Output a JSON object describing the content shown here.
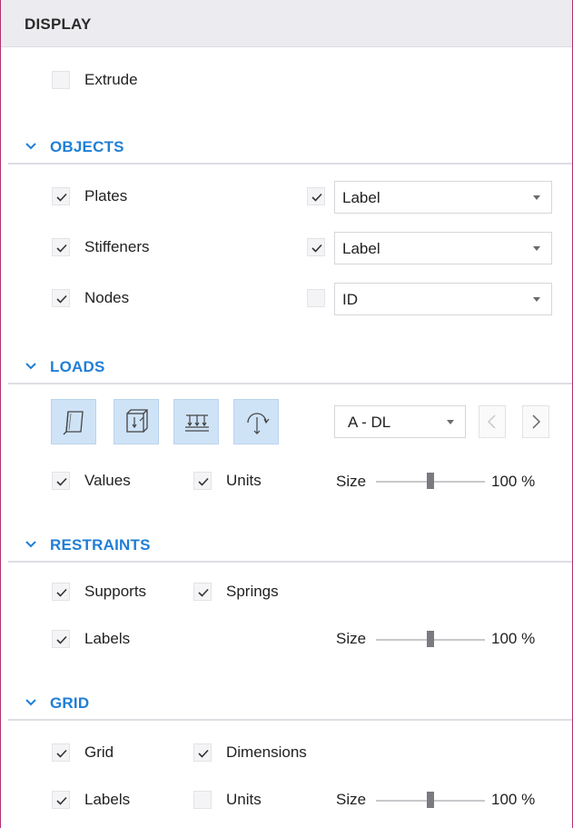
{
  "header": {
    "title": "DISPLAY"
  },
  "display": {
    "extrude_label": "Extrude",
    "extrude_checked": false
  },
  "objects": {
    "title": "OBJECTS",
    "rows": [
      {
        "label": "Plates",
        "checked": true,
        "show": true,
        "option": "Label"
      },
      {
        "label": "Stiffeners",
        "checked": true,
        "show": true,
        "option": "Label"
      },
      {
        "label": "Nodes",
        "checked": true,
        "show": false,
        "option": "ID"
      }
    ]
  },
  "loads": {
    "title": "LOADS",
    "icons": [
      "plate-load-icon",
      "edge-load-icon",
      "distributed-load-icon",
      "moment-load-icon"
    ],
    "case_select": "A - DL",
    "values_label": "Values",
    "units_label": "Units",
    "size_label": "Size",
    "size_value": "100 %",
    "size_level": 0.5
  },
  "restraints": {
    "title": "RESTRAINTS",
    "supports_label": "Supports",
    "springs_label": "Springs",
    "labels_label": "Labels",
    "size_label": "Size",
    "size_value": "100 %",
    "size_level": 0.5
  },
  "grid": {
    "title": "GRID",
    "grid_label": "Grid",
    "dimensions_label": "Dimensions",
    "labels_label": "Labels",
    "units_label": "Units",
    "units_checked": false,
    "size_label": "Size",
    "size_value": "100 %",
    "size_level": 0.5
  },
  "colors": {
    "accent": "#1f7fd6",
    "border": "#b3306f",
    "icon_bg": "#cfe3f7"
  }
}
